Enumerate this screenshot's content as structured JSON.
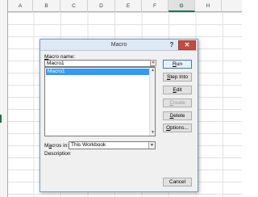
{
  "sheet": {
    "columns": [
      "A",
      "B",
      "C",
      "D",
      "E",
      "F",
      "G",
      "H"
    ],
    "selected_column": "G"
  },
  "dialog": {
    "title": "Macro",
    "help_label": "?",
    "close_label": "✕",
    "macro_name_label": "Macro name:",
    "macro_name_value": "Macro1",
    "macro_list": [
      "Macro1"
    ],
    "macros_in_label": "Macros in:",
    "macros_in_value": "This Workbook",
    "description_label": "Description",
    "buttons": {
      "run": "Run",
      "step_into": "Step Into",
      "edit": "Edit",
      "create": "Create",
      "delete": "Delete",
      "options": "Options...",
      "cancel": "Cancel"
    }
  },
  "icons": {
    "scroll_up": "▲",
    "scroll_down": "▼",
    "dropdown": "▼",
    "macro_name_icon": "⌗"
  },
  "colors": {
    "accent": "#217346",
    "selection": "#3399ff",
    "close": "#c74a3f"
  }
}
